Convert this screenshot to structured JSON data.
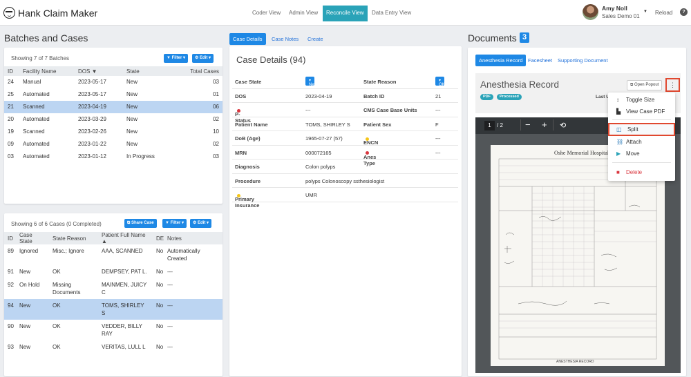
{
  "app": {
    "title": "Hank Claim Maker"
  },
  "nav": {
    "coder_view": "Coder View",
    "admin_view": "Admin View",
    "reconcile_view": "Reconcile View",
    "data_entry_view": "Data Entry View"
  },
  "user": {
    "name": "Amy Noll",
    "role": "Sales Demo 01",
    "reload": "Reload",
    "help": "?"
  },
  "batches": {
    "heading": "Batches and Cases",
    "showing": "Showing 7 of 7 Batches",
    "filter_label": "Filter",
    "edit_label": "Edit",
    "columns": [
      "ID",
      "Facility Name",
      "DOS",
      "State",
      "Total Cases"
    ],
    "rows": [
      [
        "24",
        "Manual",
        "2023-05-17",
        "New",
        "03"
      ],
      [
        "25",
        "Automated",
        "2023-05-17",
        "New",
        "01"
      ],
      [
        "21",
        "Scanned",
        "2023-04-19",
        "New",
        "06"
      ],
      [
        "20",
        "Automated",
        "2023-03-29",
        "New",
        "02"
      ],
      [
        "19",
        "Scanned",
        "2023-02-26",
        "New",
        "10"
      ],
      [
        "09",
        "Automated",
        "2023-01-22",
        "New",
        "02"
      ],
      [
        "03",
        "Automated",
        "2023-01-12",
        "In Progress",
        "03"
      ]
    ]
  },
  "cases": {
    "showing": "Showing 6 of 6 Cases (0 Completed)",
    "share_label": "Share Case",
    "filter_label": "Filter",
    "edit_label": "Edit",
    "columns": [
      "ID",
      "Case State",
      "State Reason",
      "Patient Full Name",
      "DE",
      "Notes"
    ],
    "rows": [
      [
        "89",
        "Ignored",
        "Misc.; Ignore",
        "AAA, SCANNED",
        "No",
        "Automatically Created"
      ],
      [
        "91",
        "New",
        "OK",
        "DEMPSEY, PAT L.",
        "No",
        "---"
      ],
      [
        "92",
        "On Hold",
        "Missing Documents",
        "MAINMEN, JUICY C",
        "No",
        "---"
      ],
      [
        "94",
        "New",
        "OK",
        "TOMS, SHIRLEY S",
        "No",
        "---"
      ],
      [
        "90",
        "New",
        "OK",
        "VEDDER, BILLY RAY",
        "No",
        "---"
      ],
      [
        "93",
        "New",
        "OK",
        "VERITAS, LULL L",
        "No",
        "---"
      ]
    ]
  },
  "case_tabs": {
    "details": "Case Details",
    "notes": "Case Notes",
    "create": "Create"
  },
  "case_details": {
    "title": "Case Details (94)",
    "case_state_label": "Case State",
    "case_state_value": "New",
    "state_reason_label": "State Reason",
    "state_reason_value": "OK",
    "dos_label": "DOS",
    "dos_value": "2023-04-19",
    "batch_label": "Batch ID",
    "batch_value": "21",
    "pstatus_label": "P-Status",
    "pstatus_value": "---",
    "cms_label": "CMS Case Base Units",
    "cms_value": "---",
    "patient_name_label": "Patient Name",
    "patient_name_value": "TOMS, SHIRLEY S",
    "patient_sex_label": "Patient Sex",
    "patient_sex_value": "F",
    "dob_label": "DoB (Age)",
    "dob_value": "1965-07-27 (57)",
    "encn_label": "ENCN",
    "encn_value": "---",
    "mrn_label": "MRN",
    "mrn_value": "000072165",
    "anes_label": "Anes Type",
    "anes_value": "---",
    "diagnosis_label": "Diagnosis",
    "diagnosis_value": "Colon polyps",
    "procedure_label": "Procedure",
    "procedure_value": "polyps Colonoscopy ssthesiologist",
    "insurance_label": "Primary Insurance",
    "insurance_value": "UMR"
  },
  "documents": {
    "heading": "Documents",
    "count": "3",
    "tabs": [
      "Anesthesia Record",
      "Facesheet",
      "Supporting Document"
    ],
    "doc_title": "Anesthesia Record",
    "badges": [
      "PDF",
      "Processed"
    ],
    "open_popout": "Open Popout",
    "last_fragment": "Last U",
    "pdf_page": "1",
    "pdf_total": "/ 2",
    "page_header": "Oshe Memorial Hospital",
    "page_footer": "ANESTHESIA RECORD",
    "menu": [
      "Toggle Size",
      "View Case PDF",
      "Split",
      "Attach",
      "Move",
      "Delete"
    ]
  },
  "colors": {
    "accent": "#1e88e5",
    "teal": "#2aa3b8",
    "highlight": "#e0482f",
    "selected_row": "#bcd5f2"
  }
}
